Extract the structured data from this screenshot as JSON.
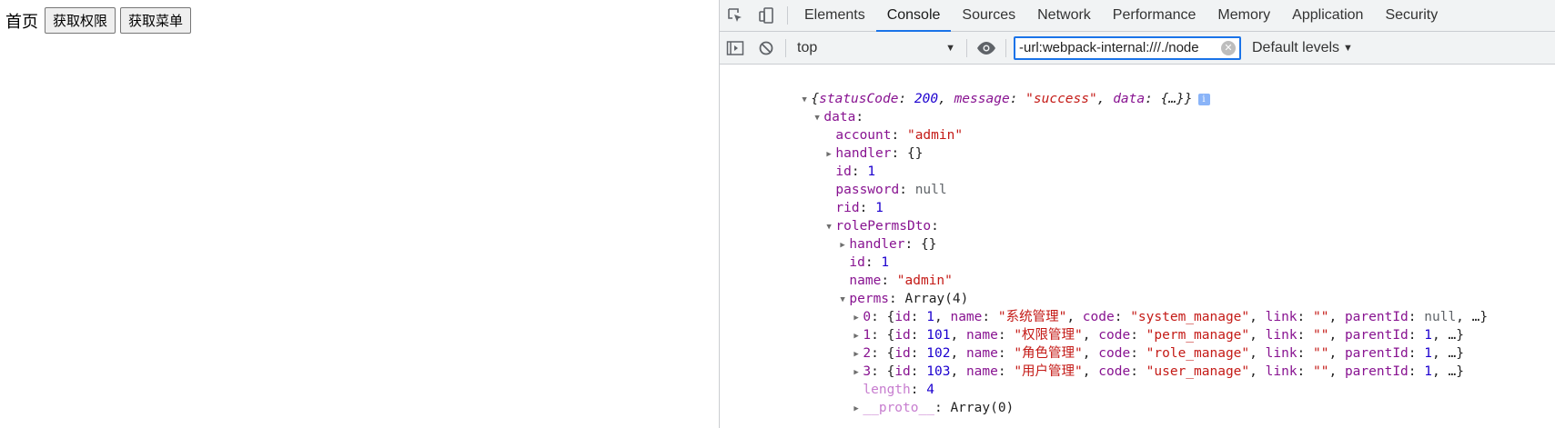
{
  "page": {
    "home_text": "首页",
    "get_perms_button": "获取权限",
    "get_menu_button": "获取菜单"
  },
  "devtools": {
    "tabs": [
      "Elements",
      "Console",
      "Sources",
      "Network",
      "Performance",
      "Memory",
      "Application",
      "Security"
    ],
    "active_tab": "Console",
    "context": "top",
    "filter_value": "-url:webpack-internal:///./node",
    "levels": "Default levels",
    "accent_color": "#1a73e8",
    "icons": [
      "inspect-element-icon",
      "device-toolbar-icon",
      "sidebar-toggle-icon",
      "clear-console-icon",
      "live-expression-eye-icon",
      "clear-filter-icon",
      "info-icon"
    ]
  },
  "console": {
    "root": {
      "open": "{",
      "statusCode_key": "statusCode",
      "statusCode_val": "200",
      "message_key": "message",
      "message_val": "\"success\"",
      "data_key": "data",
      "data_val": "{…}",
      "close": "}"
    },
    "data_label": "data",
    "account_key": "account",
    "account_val": "\"admin\"",
    "handler_key": "handler",
    "handler_val": "{}",
    "id_key": "id",
    "id_val": "1",
    "password_key": "password",
    "password_val": "null",
    "rid_key": "rid",
    "rid_val": "1",
    "rolePermsDto_key": "rolePermsDto",
    "rp_handler_key": "handler",
    "rp_handler_val": "{}",
    "rp_id_key": "id",
    "rp_id_val": "1",
    "rp_name_key": "name",
    "rp_name_val": "\"admin\"",
    "perms_key": "perms",
    "perms_val": "Array(4)",
    "perms": [
      {
        "idx": "0",
        "id": "1",
        "name": "\"系统管理\"",
        "code": "\"system_manage\"",
        "link": "\"\"",
        "parentId": "null",
        "parentId_type": "null",
        "rest": "…"
      },
      {
        "idx": "1",
        "id": "101",
        "name": "\"权限管理\"",
        "code": "\"perm_manage\"",
        "link": "\"\"",
        "parentId": "1",
        "parentId_type": "num",
        "rest": "…"
      },
      {
        "idx": "2",
        "id": "102",
        "name": "\"角色管理\"",
        "code": "\"role_manage\"",
        "link": "\"\"",
        "parentId": "1",
        "parentId_type": "num",
        "rest": "…"
      },
      {
        "idx": "3",
        "id": "103",
        "name": "\"用户管理\"",
        "code": "\"user_manage\"",
        "link": "\"\"",
        "parentId": "1",
        "parentId_type": "num",
        "rest": "…"
      }
    ],
    "length_key": "length",
    "length_val": "4",
    "proto_key": "__proto__",
    "proto_val": "Array(0)"
  }
}
